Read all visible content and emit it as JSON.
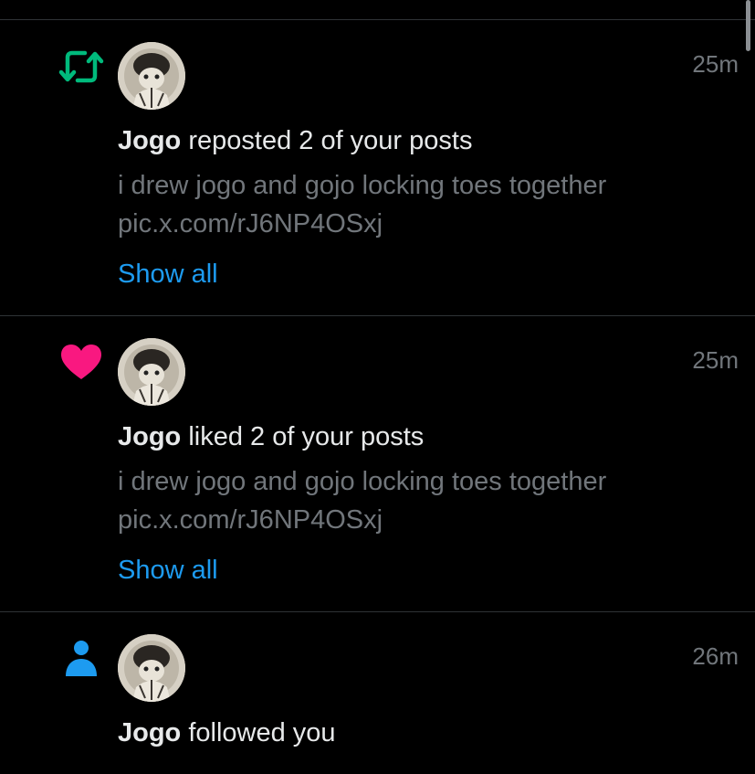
{
  "notifications": [
    {
      "type_icon": "repost-icon",
      "type_color": "#00ba7c",
      "user": "Jogo",
      "action": " reposted 2 of your posts",
      "post_text": "i drew jogo and gojo locking toes together",
      "post_link": "pic.x.com/rJ6NP4OSxj",
      "show_all": "Show all",
      "timestamp": "25m"
    },
    {
      "type_icon": "heart-icon",
      "type_color": "#f91880",
      "user": "Jogo",
      "action": " liked 2 of your posts",
      "post_text": "i drew jogo and gojo locking toes together",
      "post_link": "pic.x.com/rJ6NP4OSxj",
      "show_all": "Show all",
      "timestamp": "25m"
    },
    {
      "type_icon": "person-icon",
      "type_color": "#1d9bf0",
      "user": "Jogo",
      "action": " followed you",
      "timestamp": "26m"
    }
  ],
  "colors": {
    "background": "#000000",
    "primary_text": "#e7e9ea",
    "secondary_text": "#71767b",
    "link": "#1d9bf0",
    "divider": "#2f3336"
  }
}
